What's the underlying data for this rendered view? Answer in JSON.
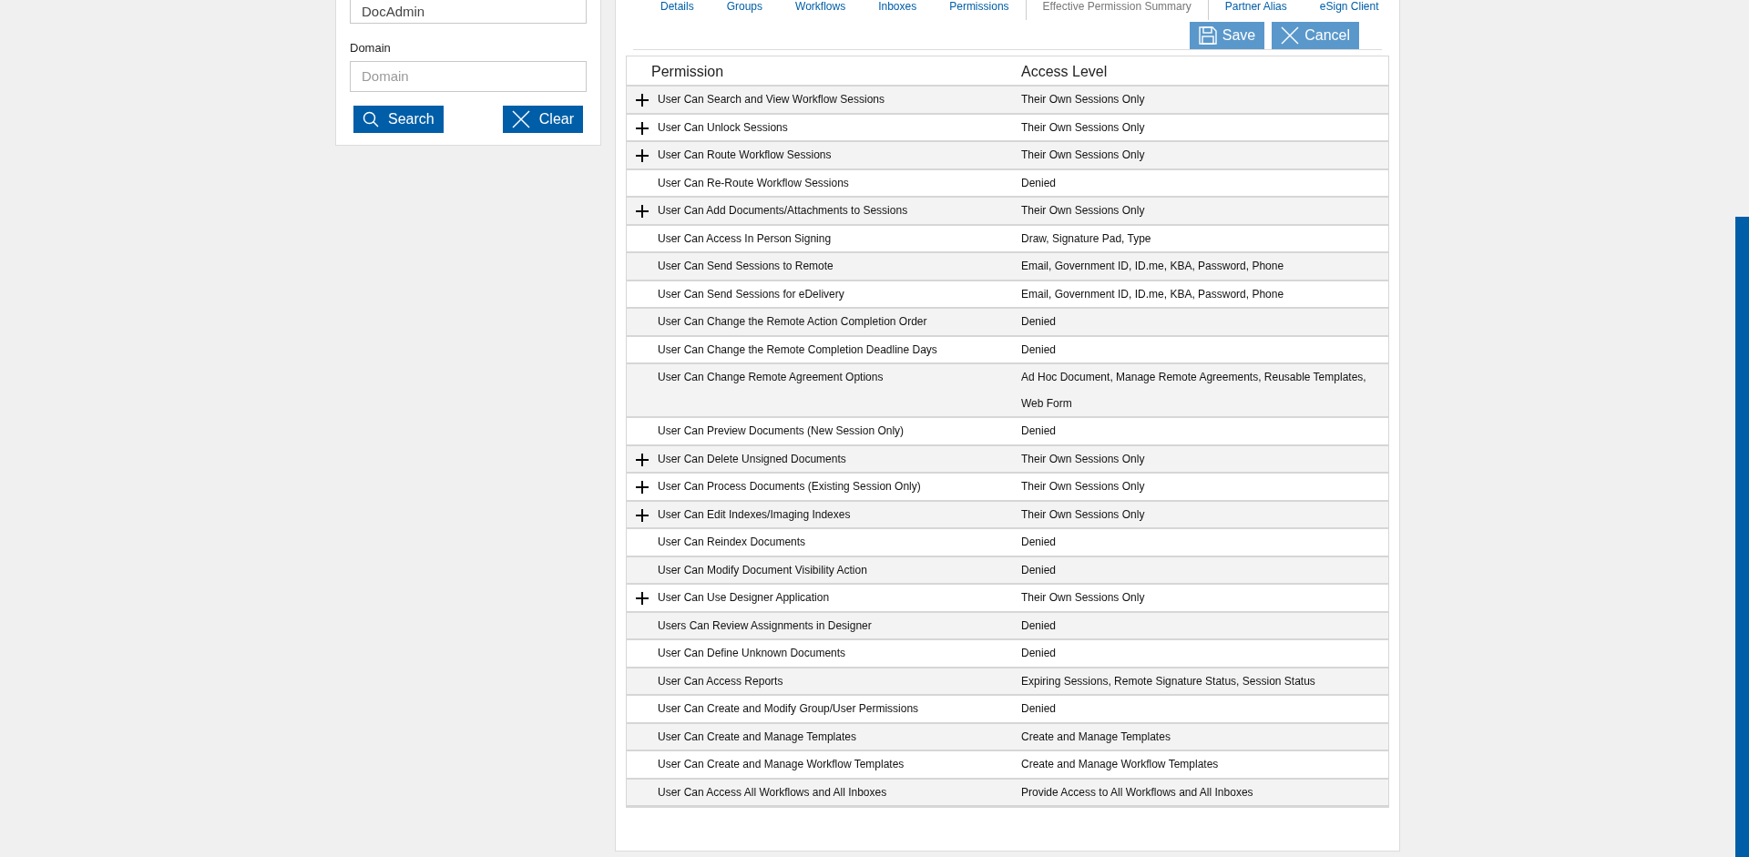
{
  "user_search": {
    "username_value": "DocAdmin",
    "domain_label": "Domain",
    "domain_placeholder": "Domain",
    "buttons": [
      {
        "kind": "search",
        "label": "Search"
      },
      {
        "kind": "clear",
        "label": "Clear"
      }
    ]
  },
  "tabs": [
    {
      "label": "Details",
      "selected": false
    },
    {
      "label": "Groups",
      "selected": false
    },
    {
      "label": "Workflows",
      "selected": false
    },
    {
      "label": "Inboxes",
      "selected": false
    },
    {
      "label": "Permissions",
      "selected": false
    },
    {
      "label": "Effective Permission Summary",
      "selected": true
    },
    {
      "label": "Partner Alias",
      "selected": false
    },
    {
      "label": "eSign Client",
      "selected": false
    }
  ],
  "actions": [
    {
      "kind": "save",
      "label": "Save"
    },
    {
      "kind": "cancel",
      "label": "Cancel"
    }
  ],
  "table": {
    "columns": [
      "Permission",
      "Access Level"
    ],
    "rows": [
      {
        "permission": "User Can Search and View Workflow Sessions",
        "access": "Their Own Sessions Only",
        "expandable": true
      },
      {
        "permission": "User Can Unlock Sessions",
        "access": "Their Own Sessions Only",
        "expandable": true
      },
      {
        "permission": "User Can Route Workflow Sessions",
        "access": "Their Own Sessions Only",
        "expandable": true
      },
      {
        "permission": "User Can Re-Route Workflow Sessions",
        "access": "Denied",
        "expandable": false
      },
      {
        "permission": "User Can Add Documents/Attachments to Sessions",
        "access": "Their Own Sessions Only",
        "expandable": true
      },
      {
        "permission": "User Can Access In Person Signing",
        "access": "Draw, Signature Pad, Type",
        "expandable": false
      },
      {
        "permission": "User Can Send Sessions to Remote",
        "access": "Email, Government ID, ID.me, KBA, Password, Phone",
        "expandable": false
      },
      {
        "permission": "User Can Send Sessions for eDelivery",
        "access": "Email, Government ID, ID.me, KBA, Password, Phone",
        "expandable": false
      },
      {
        "permission": "User Can Change the Remote Action Completion Order",
        "access": "Denied",
        "expandable": false
      },
      {
        "permission": "User Can Change the Remote Completion Deadline Days",
        "access": "Denied",
        "expandable": false
      },
      {
        "permission": "User Can Change Remote Agreement Options",
        "access": "Ad Hoc Document, Manage Remote Agreements, Reusable Templates, Web Form",
        "expandable": false
      },
      {
        "permission": "User Can Preview Documents (New Session Only)",
        "access": "Denied",
        "expandable": false
      },
      {
        "permission": "User Can Delete Unsigned Documents",
        "access": "Their Own Sessions Only",
        "expandable": true
      },
      {
        "permission": "User Can Process Documents (Existing Session Only)",
        "access": "Their Own Sessions Only",
        "expandable": true
      },
      {
        "permission": "User Can Edit Indexes/Imaging Indexes",
        "access": "Their Own Sessions Only",
        "expandable": true
      },
      {
        "permission": "User Can Reindex Documents",
        "access": "Denied",
        "expandable": false
      },
      {
        "permission": "User Can Modify Document Visibility Action",
        "access": "Denied",
        "expandable": false
      },
      {
        "permission": "User Can Use Designer Application",
        "access": "Their Own Sessions Only",
        "expandable": true
      },
      {
        "permission": "Users Can Review Assignments in Designer",
        "access": "Denied",
        "expandable": false
      },
      {
        "permission": "User Can Define Unknown Documents",
        "access": "Denied",
        "expandable": false
      },
      {
        "permission": "User Can Access Reports",
        "access": "Expiring Sessions, Remote Signature Status, Session Status",
        "expandable": false
      },
      {
        "permission": "User Can Create and Modify Group/User Permissions",
        "access": "Denied",
        "expandable": false
      },
      {
        "permission": "User Can Create and Manage Templates",
        "access": "Create and Manage Templates",
        "expandable": false
      },
      {
        "permission": "User Can Create and Manage Workflow Templates",
        "access": "Create and Manage Workflow Templates",
        "expandable": false
      },
      {
        "permission": "User Can Access All Workflows and All Inboxes",
        "access": "Provide Access to All Workflows and All Inboxes",
        "expandable": false
      }
    ]
  }
}
